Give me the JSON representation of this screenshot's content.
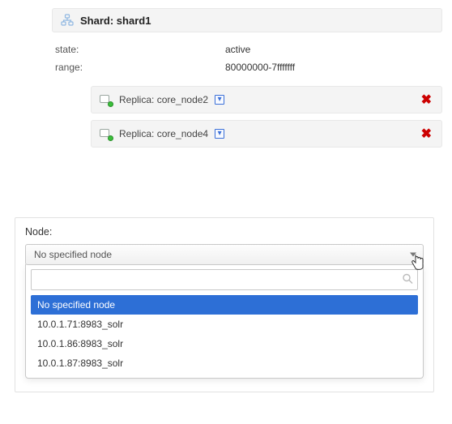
{
  "shard": {
    "title_prefix": "Shard:",
    "name": "shard1",
    "state_label": "state:",
    "state_value": "active",
    "range_label": "range:",
    "range_value": "80000000-7fffffff"
  },
  "replicas": [
    {
      "prefix": "Replica:",
      "name": "core_node2"
    },
    {
      "prefix": "Replica:",
      "name": "core_node4"
    }
  ],
  "node_section": {
    "label": "Node:",
    "selected": "No specified node",
    "search_value": "",
    "search_placeholder": "",
    "options": [
      "No specified node",
      "10.0.1.71:8983_solr",
      "10.0.1.86:8983_solr",
      "10.0.1.87:8983_solr"
    ]
  },
  "icons": {
    "expand": "▾",
    "delete": "✖",
    "search": "🔍",
    "cursor": "👆"
  }
}
